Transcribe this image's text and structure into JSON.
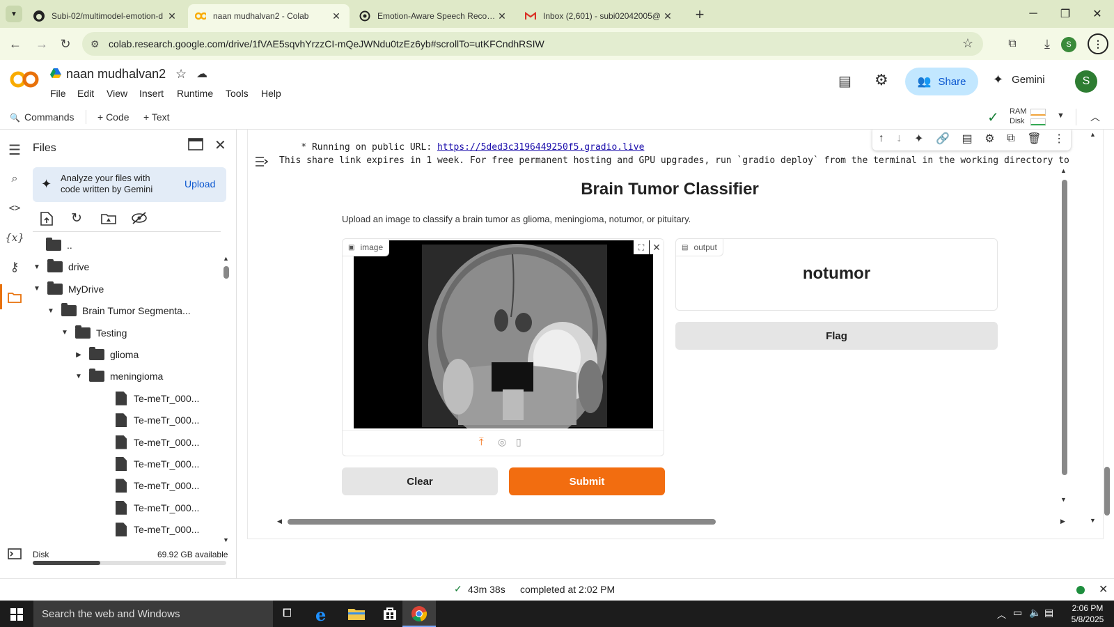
{
  "browser": {
    "tabs": [
      {
        "title": "Subi-02/multimodel-emotion-d",
        "icon": "github-icon",
        "active": false
      },
      {
        "title": "naan mudhalvan2 - Colab",
        "icon": "colab-icon",
        "active": true
      },
      {
        "title": "Emotion-Aware Speech Recogn",
        "icon": "openai-icon",
        "active": false
      },
      {
        "title": "Inbox (2,601) - subi02042005@",
        "icon": "gmail-icon",
        "active": false
      }
    ],
    "url": "colab.research.google.com/drive/1fVAE5sqvhYrzzCI-mQeJWNdu0tzEz6yb#scrollTo=utKFCndhRSIW",
    "profile_initial": "S"
  },
  "colab": {
    "notebook_title": "naan mudhalvan2",
    "menu": [
      "File",
      "Edit",
      "View",
      "Insert",
      "Runtime",
      "Tools",
      "Help"
    ],
    "share_label": "Share",
    "gemini_label": "Gemini",
    "avatar_initial": "S",
    "commands_label": "Commands",
    "add_code_label": "+ Code",
    "add_text_label": "+ Text",
    "ram_label": "RAM",
    "disk_label": "Disk"
  },
  "files_panel": {
    "title": "Files",
    "gemini_promo": "Analyze your files with code written by Gemini",
    "upload_label": "Upload",
    "tree": [
      {
        "label": "..",
        "type": "folder-open",
        "depth": 0
      },
      {
        "label": "drive",
        "type": "folder",
        "depth": 0,
        "expanded": true
      },
      {
        "label": "MyDrive",
        "type": "folder",
        "depth": 1,
        "expanded": true
      },
      {
        "label": "Brain Tumor Segmenta...",
        "type": "folder",
        "depth": 2,
        "expanded": true
      },
      {
        "label": "Testing",
        "type": "folder",
        "depth": 3,
        "expanded": true
      },
      {
        "label": "glioma",
        "type": "folder",
        "depth": 4,
        "expanded": false
      },
      {
        "label": "meningioma",
        "type": "folder",
        "depth": 4,
        "expanded": true
      },
      {
        "label": "Te-meTr_000...",
        "type": "file",
        "depth": 5
      },
      {
        "label": "Te-meTr_000...",
        "type": "file",
        "depth": 5
      },
      {
        "label": "Te-meTr_000...",
        "type": "file",
        "depth": 5
      },
      {
        "label": "Te-meTr_000...",
        "type": "file",
        "depth": 5
      },
      {
        "label": "Te-meTr_000...",
        "type": "file",
        "depth": 5
      },
      {
        "label": "Te-meTr_000...",
        "type": "file",
        "depth": 5
      },
      {
        "label": "Te-meTr_000...",
        "type": "file",
        "depth": 5
      }
    ],
    "disk_label": "Disk",
    "disk_available": "69.92 GB available"
  },
  "output": {
    "line1_prefix": "* Running on public URL: ",
    "public_url": "https://5ded3c3196449250f5.gradio.live",
    "line2": "This share link expires in 1 week. For free permanent hosting and GPU upgrades, run `gradio deploy` from the terminal in the working directory to deplo",
    "app_title": "Brain Tumor Classifier",
    "app_description": "Upload an image to classify a brain tumor as glioma, meningioma, notumor, or pituitary.",
    "image_label": "image",
    "output_label": "output",
    "prediction": "notumor",
    "flag_label": "Flag",
    "clear_label": "Clear",
    "submit_label": "Submit"
  },
  "status": {
    "elapsed": "43m 38s",
    "completed": "completed at 2:02 PM"
  },
  "taskbar": {
    "search_placeholder": "Search the web and Windows",
    "time": "2:06 PM",
    "date": "5/8/2025"
  },
  "colors": {
    "accent_orange": "#f26d10",
    "tab_strip": "#dfe9c8",
    "share_bg": "#c2e7ff"
  }
}
